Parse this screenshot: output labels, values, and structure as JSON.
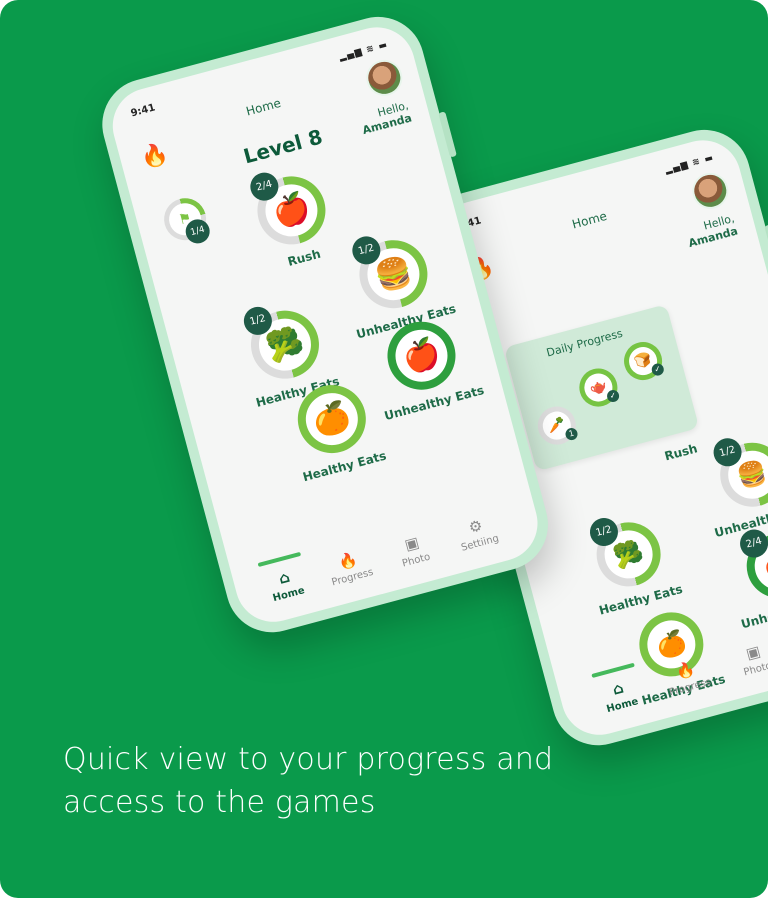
{
  "caption": "Quick view to your progress and access to the games",
  "phone_main": {
    "status_time": "9:41",
    "status_icons": "▂▄▆ ≋ ▬",
    "header_title": "Home",
    "greeting": "Hello,",
    "user_name": "Amanda",
    "level_label": "Level 8",
    "side_progress": "1/4",
    "games": [
      {
        "label": "Rush",
        "progress": "2/4",
        "icon": "apple-icon",
        "glyph": "🍎",
        "ring_color": "#7cc444",
        "fill": 0.5
      },
      {
        "label": "Unhealthy Eats",
        "progress": "1/2",
        "icon": "burger-icon",
        "glyph": "🍔",
        "ring_color": "#7cc444",
        "fill": 0.5
      },
      {
        "label": "Healthy Eats",
        "progress": "1/2",
        "icon": "broccoli-icon",
        "glyph": "🥦",
        "ring_color": "#7cc444",
        "fill": 0.5
      },
      {
        "label": "Healthy Eats",
        "progress": "",
        "icon": "orange-icon",
        "glyph": "🍊",
        "ring_color": "#7cc444",
        "fill": 1.0
      },
      {
        "label": "Unhealthy Eats",
        "progress": "",
        "icon": "apple-check-icon",
        "glyph": "🍎",
        "ring_color": "#2e9f3e",
        "fill": 1.0
      }
    ],
    "nav": [
      {
        "label": "Home",
        "icon": "home-icon",
        "glyph": "⌂"
      },
      {
        "label": "Progress",
        "icon": "flame-icon",
        "glyph": "🔥"
      },
      {
        "label": "Photo",
        "icon": "photo-icon",
        "glyph": "▣"
      },
      {
        "label": "Settiing",
        "icon": "gear-icon",
        "glyph": "⚙"
      }
    ]
  },
  "phone_secondary": {
    "status_time": "9:41",
    "status_icons": "▂▄▆ ≋ ▬",
    "header_title": "Home",
    "greeting": "Hello,",
    "user_name": "Amanda",
    "popup_title": "Daily Progress",
    "games": [
      {
        "label": "Rush",
        "progress": "",
        "glyph": "🍎"
      },
      {
        "label": "Unhealthy Eats",
        "progress": "1/2",
        "glyph": "🍔"
      },
      {
        "label": "Healthy Eats",
        "progress": "1/2",
        "glyph": "🥦"
      },
      {
        "label": "Unhealthy Eats",
        "progress": "2/4",
        "glyph": "🍎"
      },
      {
        "label": "Healthy Eats",
        "progress": "",
        "glyph": "🍊"
      }
    ],
    "nav": [
      {
        "label": "Home",
        "glyph": "⌂"
      },
      {
        "label": "Progress",
        "glyph": "🔥"
      },
      {
        "label": "Photo",
        "glyph": "▣"
      }
    ]
  },
  "colors": {
    "background": "#0a9a4b",
    "accent": "#7cc444",
    "dark_green": "#0d5a3a"
  }
}
